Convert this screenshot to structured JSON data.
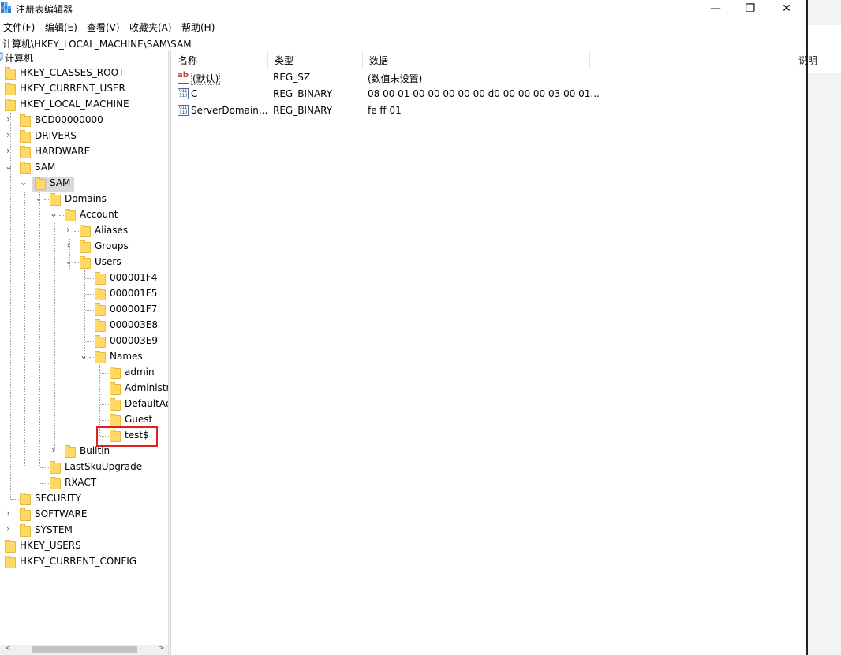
{
  "window": {
    "title": "注册表编辑器",
    "minimize_glyph": "—",
    "maximize_glyph": "❐",
    "close_glyph": "✕"
  },
  "menu": {
    "file": "文件(F)",
    "edit": "编辑(E)",
    "view": "查看(V)",
    "favorites": "收藏夹(A)",
    "help": "帮助(H)"
  },
  "address": "计算机\\HKEY_LOCAL_MACHINE\\SAM\\SAM",
  "tree": {
    "computer": "计算机",
    "hkcr": "HKEY_CLASSES_ROOT",
    "hkcu": "HKEY_CURRENT_USER",
    "hklm": "HKEY_LOCAL_MACHINE",
    "bcd": "BCD00000000",
    "drivers": "DRIVERS",
    "hardware": "HARDWARE",
    "sam": "SAM",
    "sam_sam": "SAM",
    "domains": "Domains",
    "account": "Account",
    "aliases": "Aliases",
    "groups": "Groups",
    "users": "Users",
    "u1": "000001F4",
    "u2": "000001F5",
    "u3": "000001F7",
    "u4": "000003E8",
    "u5": "000003E9",
    "names": "Names",
    "n_admin": "admin",
    "n_administrator": "Administr",
    "n_defaultaccount": "DefaultAc",
    "n_guest": "Guest",
    "n_test": "test$",
    "builtin": "Builtin",
    "lastsku": "LastSkuUpgrade",
    "rxact": "RXACT",
    "security": "SECURITY",
    "software": "SOFTWARE",
    "system": "SYSTEM",
    "hku": "HKEY_USERS",
    "hkcc": "HKEY_CURRENT_CONFIG"
  },
  "columns": {
    "name": "名称",
    "type": "类型",
    "data": "数据"
  },
  "values": [
    {
      "name": "(默认)",
      "type": "REG_SZ",
      "data": "(数值未设置)",
      "icon": "string-value-icon"
    },
    {
      "name": "C",
      "type": "REG_BINARY",
      "data": "08 00 01 00 00 00 00 00 d0 00 00 00 03 00 01...",
      "icon": "binary-value-icon"
    },
    {
      "name": "ServerDomain...",
      "type": "REG_BINARY",
      "data": "fe ff 01",
      "icon": "binary-value-icon"
    }
  ],
  "icons": {
    "ab": "ab",
    "bin": "011 110"
  },
  "right_window": {
    "partial_text": "说明"
  },
  "colors": {
    "highlight_border": "#e02020",
    "folder": "#ffd966",
    "selection": "#d9d9d9"
  }
}
